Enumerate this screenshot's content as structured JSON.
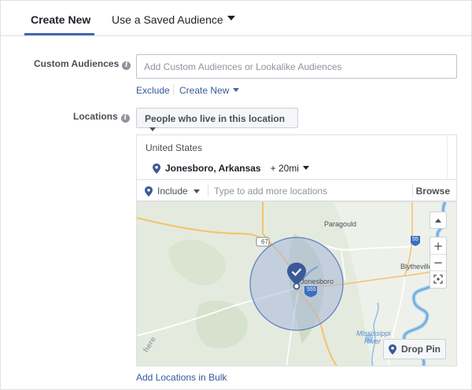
{
  "tabs": {
    "create_new": "Create New",
    "saved_audience": "Use a Saved Audience"
  },
  "custom_audiences": {
    "label": "Custom Audiences",
    "placeholder": "Add Custom Audiences or Lookalike Audiences",
    "exclude": "Exclude",
    "create_new": "Create New"
  },
  "locations": {
    "label": "Locations",
    "type_dropdown": "People who live in this location",
    "country": "United States",
    "city": "Jonesboro, Arkansas",
    "radius": "+ 20mi",
    "include": "Include",
    "search_placeholder": "Type to add more locations",
    "browse": "Browse",
    "add_bulk": "Add Locations in Bulk"
  },
  "map": {
    "labels": {
      "paragould": "Paragould",
      "jonesboro": "Jonesboro",
      "blytheville": "Blytheville",
      "mississippi": "Mississippi",
      "river": "River",
      "hwy67": "67",
      "hwy555": "555",
      "hwy55": "55",
      "here": "here"
    },
    "zoom_in": "+",
    "zoom_out": "−",
    "drop_pin": "Drop Pin"
  },
  "colors": {
    "accent": "#4267b2",
    "link": "#365899",
    "pin": "#3b5998",
    "radius_fill": "#a9b8dd"
  }
}
